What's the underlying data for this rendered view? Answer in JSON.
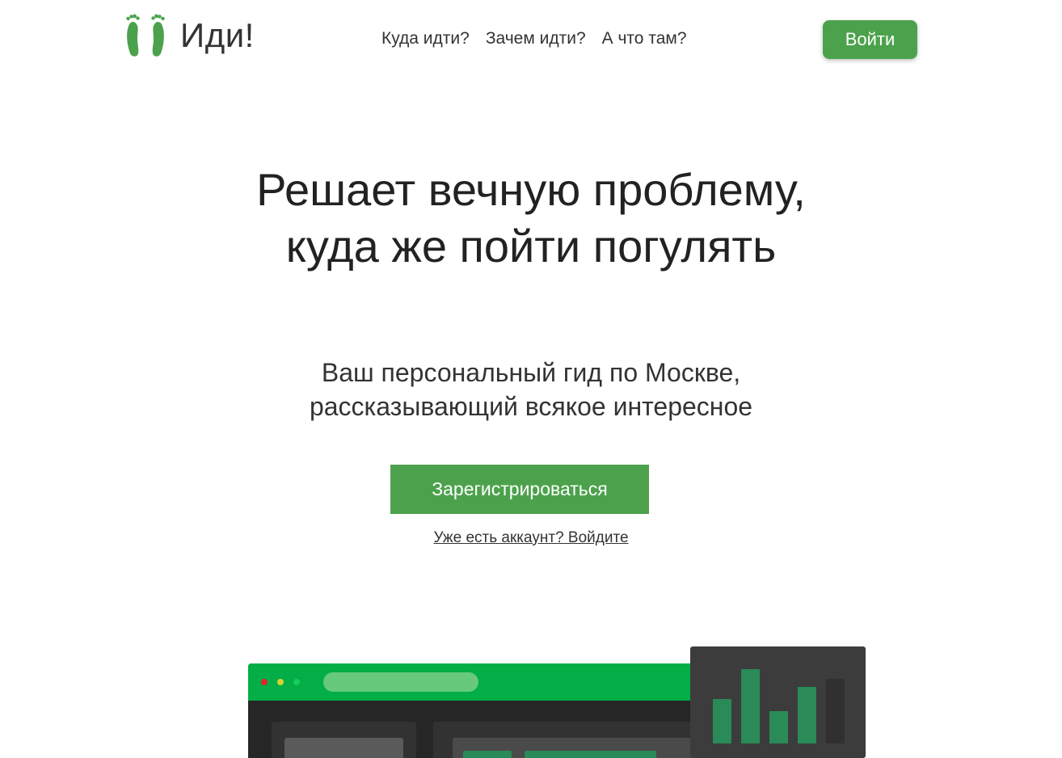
{
  "brand": {
    "name": "Иди!"
  },
  "nav": {
    "items": [
      {
        "label": "Куда идти?"
      },
      {
        "label": "Зачем идти?"
      },
      {
        "label": "А что там?"
      }
    ]
  },
  "header": {
    "login_label": "Войти"
  },
  "hero": {
    "title_line1": "Решает вечную проблему,",
    "title_line2": "куда же пойти погулять",
    "subtitle_line1": "Ваш персональный гид по Москве,",
    "subtitle_line2": "рассказывающий всякое интересное",
    "signup_label": "Зарегистрироваться",
    "login_link_label": "Уже есть аккаунт? Войдите"
  },
  "colors": {
    "accent": "#4ca24c",
    "browser_bar": "#04ae47",
    "dark_panel": "#262626",
    "chart_card": "#3c3c3c",
    "bar_green": "#2a8a58",
    "bar_dark": "#303030"
  },
  "illustration": {
    "chart_bars": [
      {
        "value": 0.55,
        "color": "#2a8a58"
      },
      {
        "value": 0.92,
        "color": "#2a8a58"
      },
      {
        "value": 0.4,
        "color": "#2a8a58"
      },
      {
        "value": 0.7,
        "color": "#2a8a58"
      },
      {
        "value": 0.8,
        "color": "#303030"
      }
    ]
  }
}
